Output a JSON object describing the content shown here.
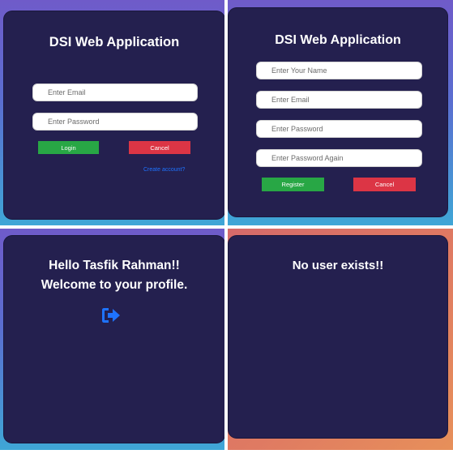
{
  "login": {
    "title": "DSI Web Application",
    "email_placeholder": "Enter Email",
    "password_placeholder": "Enter Password",
    "login_label": "Login",
    "cancel_label": "Cancel",
    "create_account_label": "Create account?"
  },
  "register": {
    "title": "DSI Web Application",
    "name_placeholder": "Enter Your Name",
    "email_placeholder": "Enter Email",
    "password_placeholder": "Enter Password",
    "password_again_placeholder": "Enter Password Again",
    "register_label": "Register",
    "cancel_label": "Cancel"
  },
  "profile": {
    "greeting": "Hello Tasfik Rahman!!",
    "welcome": "Welcome to your profile.",
    "logout_icon": "sign-out-icon"
  },
  "error": {
    "message": "No user exists!!"
  },
  "colors": {
    "card_background": "#24204f",
    "green_button": "#28a745",
    "red_button": "#dc3545",
    "link": "#1e73ff",
    "icon_blue": "#1e73ff"
  }
}
